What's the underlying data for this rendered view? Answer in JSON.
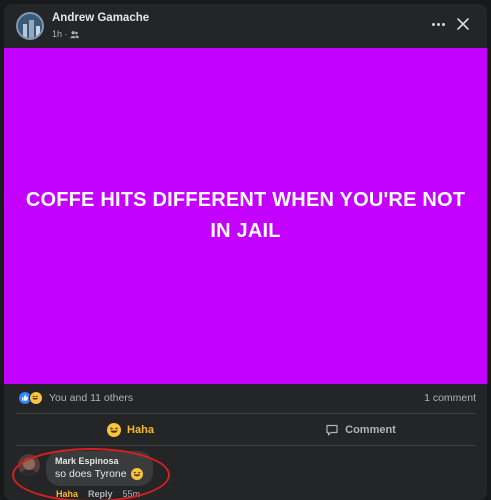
{
  "post": {
    "author": "Andrew Gamache",
    "time": "1h ·",
    "audience_icon": "friends-icon",
    "image_text": "COFFE HITS DIFFERENT WHEN YOU'RE NOT IN JAIL",
    "image_bg": "#c400ff"
  },
  "reactions": {
    "icons": [
      "like-icon",
      "haha-icon"
    ],
    "summary": "You and 11 others",
    "comment_count": "1 comment"
  },
  "actions": {
    "haha_label": "Haha",
    "comment_label": "Comment"
  },
  "comment": {
    "author": "Mark Espinosa",
    "text": "so does Tyrone",
    "haha_label": "Haha",
    "reply_label": "Reply",
    "time": "55m"
  },
  "colors": {
    "background": "#242526",
    "haha_accent": "#f7b928",
    "like_blue": "#2d88ff",
    "highlight_red": "#d61f1f"
  }
}
